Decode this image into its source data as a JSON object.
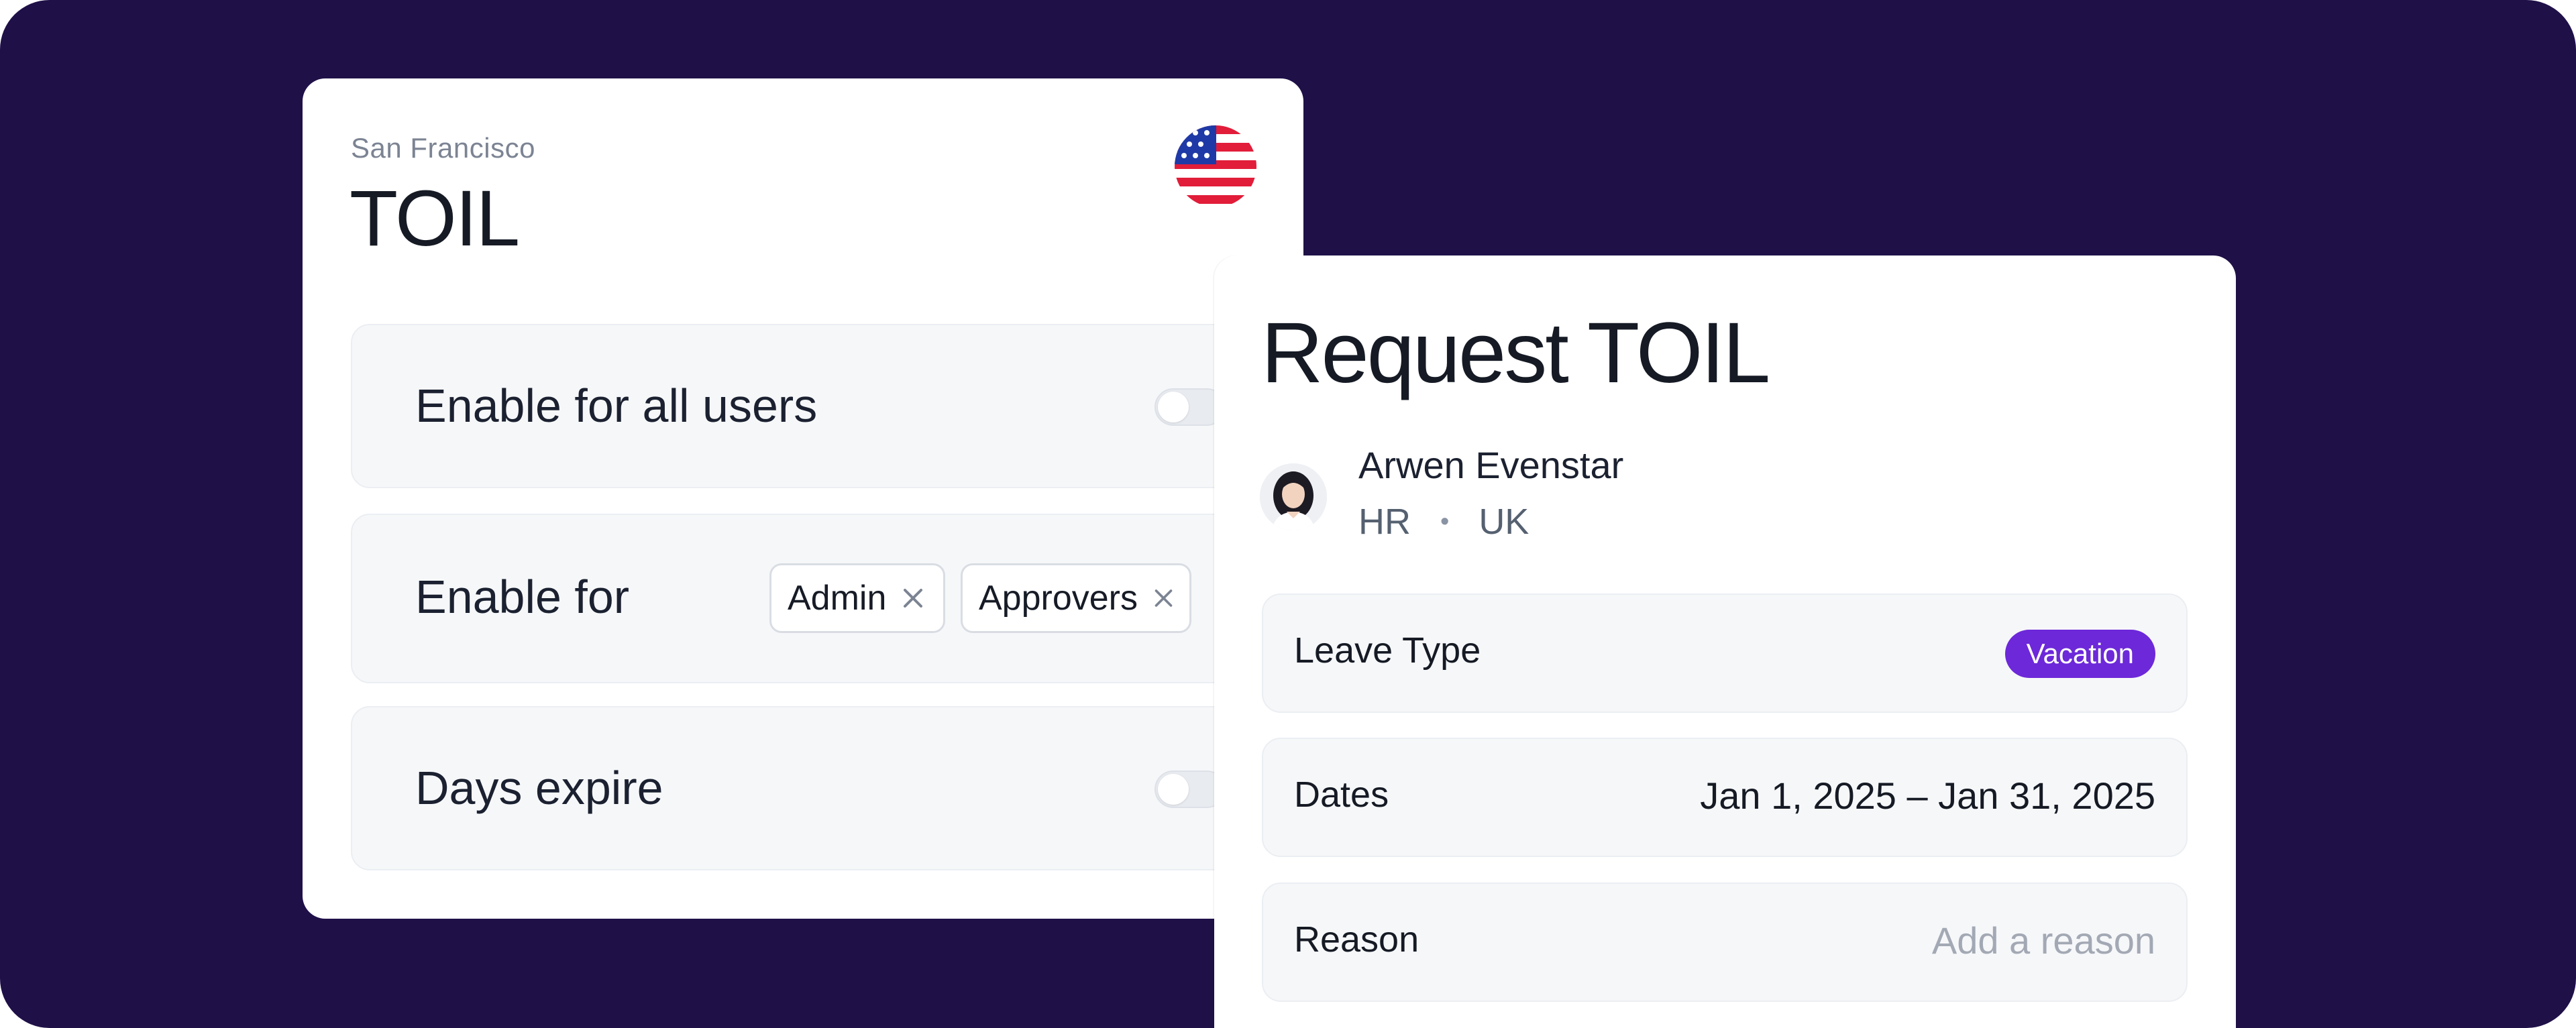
{
  "settings_card": {
    "location": "San Francisco",
    "title": "TOIL",
    "flag_icon": "us-flag-icon",
    "rows": {
      "enable_all": {
        "label": "Enable for all users",
        "toggle_on": false
      },
      "enable_for": {
        "label": "Enable for",
        "chips": [
          {
            "label": "Admin"
          },
          {
            "label": "Approvers"
          }
        ]
      },
      "days_expire": {
        "label": "Days expire",
        "toggle_on": false
      }
    }
  },
  "request_card": {
    "title": "Request TOIL",
    "person": {
      "name": "Arwen Evenstar",
      "department": "HR",
      "separator": "•",
      "country": "UK"
    },
    "fields": {
      "leave_type": {
        "label": "Leave Type",
        "value": "Vacation"
      },
      "dates": {
        "label": "Dates",
        "value": "Jan 1, 2025 – Jan 31, 2025"
      },
      "reason": {
        "label": "Reason",
        "placeholder": "Add a reason"
      }
    }
  },
  "colors": {
    "background": "#1f1048",
    "card": "#ffffff",
    "row_bg": "#f6f7f9",
    "badge": "#6d28d9",
    "text": "#151a24",
    "muted": "#7c8493"
  }
}
